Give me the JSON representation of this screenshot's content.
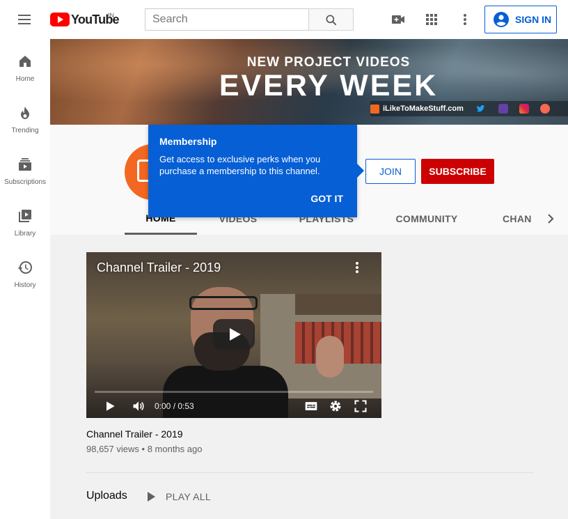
{
  "topbar": {
    "logo_text": "YouTube",
    "country_code": "IN",
    "search_placeholder": "Search",
    "signin_label": "SIGN IN",
    "icons": [
      "menu-icon",
      "video-camera-icon",
      "apps-grid-icon",
      "more-vert-icon",
      "account-icon"
    ]
  },
  "sidebar": {
    "items": [
      {
        "label": "Home",
        "icon": "home-icon"
      },
      {
        "label": "Trending",
        "icon": "flame-icon"
      },
      {
        "label": "Subscriptions",
        "icon": "subscriptions-icon"
      },
      {
        "label": "Library",
        "icon": "library-icon"
      },
      {
        "label": "History",
        "icon": "history-icon"
      }
    ]
  },
  "banner": {
    "line1": "NEW PROJECT VIDEOS",
    "line2": "EVERY WEEK",
    "site_link": "iLikeToMakeStuff.com",
    "social_icons": [
      "twitter-icon",
      "twitch-icon",
      "instagram-icon",
      "patreon-icon"
    ]
  },
  "channel": {
    "join_label": "JOIN",
    "subscribe_label": "SUBSCRIBE",
    "tabs": [
      "HOME",
      "VIDEOS",
      "PLAYLISTS",
      "COMMUNITY",
      "CHAN"
    ],
    "active_tab": "HOME"
  },
  "popup": {
    "title": "Membership",
    "body": "Get access to exclusive perks when you purchase a membership to this channel.",
    "action": "GOT IT"
  },
  "trailer": {
    "overlay_title": "Channel Trailer - 2019",
    "time": "0:00 / 0:53",
    "title": "Channel Trailer - 2019",
    "views": "98,657 views",
    "age": "8 months ago"
  },
  "uploads": {
    "heading": "Uploads",
    "play_all": "PLAY ALL"
  },
  "colors": {
    "brand_red": "#ff0000",
    "subscribe_red": "#cc0000",
    "link_blue": "#065fd4"
  }
}
